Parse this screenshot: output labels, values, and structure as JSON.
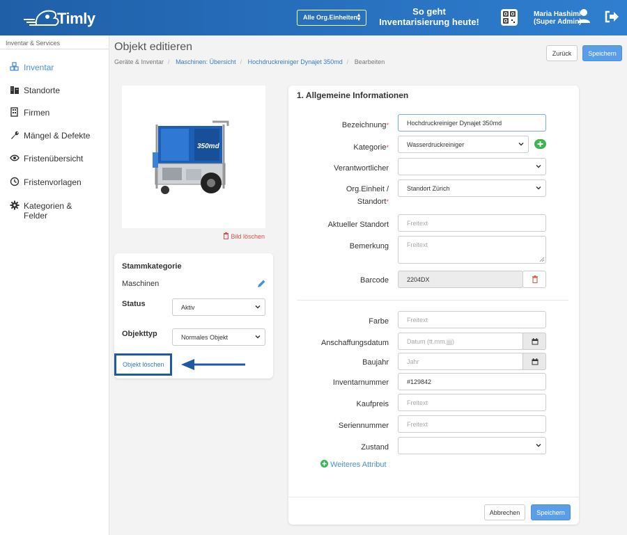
{
  "header": {
    "logo_text": "Timly",
    "org_select": "Alle Org.Einheiten",
    "promo_line1": "So geht",
    "promo_line2": "Inventarisierung heute!",
    "user_name": "Maria Hashimi",
    "user_role": "(Super Admin)"
  },
  "sidebar": {
    "section": "Inventar & Services",
    "items": [
      {
        "label": "Inventar",
        "icon": "cubes-icon"
      },
      {
        "label": "Standorte",
        "icon": "building-icon"
      },
      {
        "label": "Firmen",
        "icon": "office-icon"
      },
      {
        "label": "Mängel & Defekte",
        "icon": "wrench-icon"
      },
      {
        "label": "Fristenübersicht",
        "icon": "eye-icon"
      },
      {
        "label": "Fristenvorlagen",
        "icon": "clock-icon"
      },
      {
        "label": "Kategorien &",
        "label2": "Felder",
        "icon": "gear-icon"
      }
    ]
  },
  "page": {
    "title": "Objekt editieren",
    "breadcrumb": [
      "Geräte & Inventar",
      "Maschinen: Übersicht",
      "Hochdruckreiniger Dynajet 350md",
      "Bearbeiten"
    ],
    "back_button": "Zurück",
    "save_button": "Speichern"
  },
  "left": {
    "delete_image": "Bild löschen",
    "image_label": "350md",
    "stamm_title": "Stammkategorie",
    "stamm_value": "Maschinen",
    "status_label": "Status",
    "status_value": "Aktiv",
    "objtype_label": "Objekttyp",
    "objtype_value": "Normales Objekt",
    "delete_object": "Objekt löschen"
  },
  "form": {
    "section_title": "1. Allgemeine Informationen",
    "bezeichnung_label": "Bezeichnung",
    "bezeichnung_value": "Hochdruckreiniger Dynajet 350md",
    "kategorie_label": "Kategorie",
    "kategorie_value": "Wasserdruckreiniger",
    "verantwortlicher_label": "Verantwortlicher",
    "verantwortlicher_value": "",
    "org_label_1": "Org.Einheit /",
    "org_label_2": "Standort",
    "org_value": "Standort Zürich",
    "aktueller_label": "Aktueller Standort",
    "aktueller_placeholder": "Freitext",
    "bemerkung_label": "Bemerkung",
    "bemerkung_placeholder": "Freitext",
    "barcode_label": "Barcode",
    "barcode_value": "2204DX",
    "farbe_label": "Farbe",
    "farbe_placeholder": "Freitext",
    "anschaffung_label": "Anschaffungsdatum",
    "anschaffung_placeholder": "Datum (tt.mm.jjjj)",
    "baujahr_label": "Baujahr",
    "baujahr_placeholder": "Jahr",
    "inventar_label": "Inventarnummer",
    "inventar_value": "#129842",
    "kaufpreis_label": "Kaufpreis",
    "kaufpreis_placeholder": "Freitext",
    "serien_label": "Seriennummer",
    "serien_placeholder": "Freitext",
    "zustand_label": "Zustand",
    "zustand_value": "",
    "add_attribute": "Weiteres Attribut",
    "cancel_button": "Abbrechen",
    "save_button": "Speichern"
  },
  "colors": {
    "header_start": "#1f5fa8",
    "header_end": "#2f7fd0",
    "primary": "#5b9ee8",
    "link": "#3a7bc8",
    "danger": "#d9534f",
    "success": "#3cb653",
    "highlight": "#1f5aa0"
  }
}
